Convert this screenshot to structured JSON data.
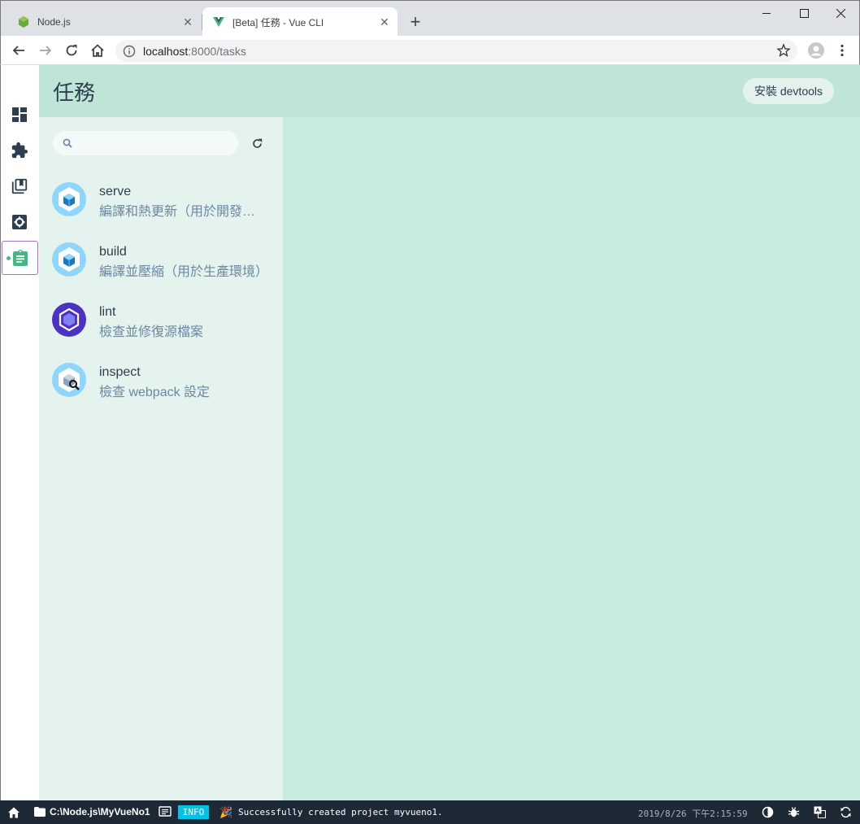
{
  "browser": {
    "tabs": [
      {
        "title": "Node.js",
        "active": false
      },
      {
        "title": "[Beta] 任務 - Vue CLI",
        "active": true
      }
    ],
    "url_host": "localhost",
    "url_path": ":8000/tasks"
  },
  "header": {
    "title": "任務",
    "devtools_label": "安裝 devtools"
  },
  "sidebar": {
    "items": [
      {
        "name": "dashboard",
        "icon": "dashboard-icon"
      },
      {
        "name": "plugins",
        "icon": "puzzle-icon"
      },
      {
        "name": "dependencies",
        "icon": "library-books-icon"
      },
      {
        "name": "configuration",
        "icon": "settings-icon"
      },
      {
        "name": "tasks",
        "icon": "clipboard-icon",
        "selected": true
      }
    ]
  },
  "search": {
    "value": "",
    "placeholder": ""
  },
  "tasks": [
    {
      "name": "serve",
      "description": "編譯和熱更新（用於開發環境）",
      "icon": "webpack-cube-icon"
    },
    {
      "name": "build",
      "description": "編譯並壓縮（用於生產環境）",
      "icon": "webpack-cube-icon"
    },
    {
      "name": "lint",
      "description": "檢查並修復源檔案",
      "icon": "eslint-hexagon-icon"
    },
    {
      "name": "inspect",
      "description": "檢查 webpack 設定",
      "icon": "webpack-inspect-icon"
    }
  ],
  "statusbar": {
    "path": "C:\\Node.js\\MyVueNo1",
    "level": "INFO",
    "message": "Successfully created project myvueno1.",
    "time": "2019/8/26 下午2:15:59"
  },
  "colors": {
    "header": "#bee5d6",
    "panel": "#e4f3ed",
    "content": "#c8ebdf",
    "accent": "#42b983",
    "statusbar": "#1d2935"
  }
}
